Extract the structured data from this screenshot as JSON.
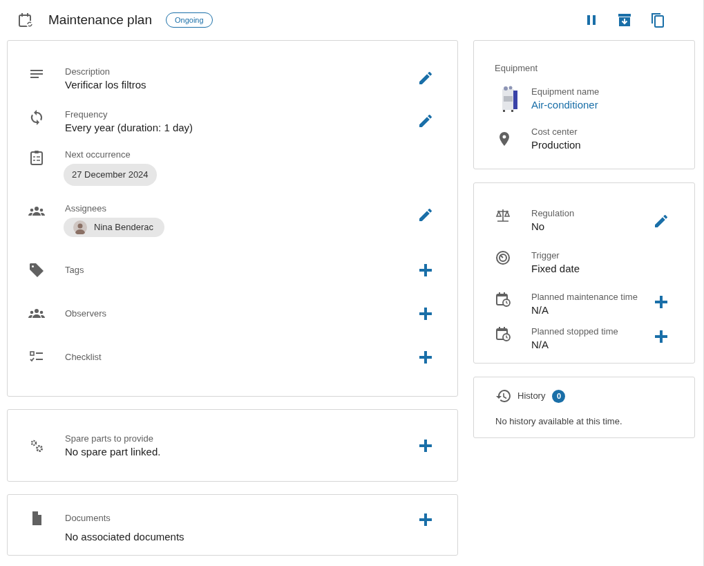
{
  "header": {
    "title": "Maintenance plan",
    "status": "Ongoing"
  },
  "details": {
    "rows": [
      {
        "label": "Description",
        "value": "Verificar los filtros",
        "action": {
          "kind": "edit"
        }
      },
      {
        "label": "Frequency",
        "value": "Every year (duration: 1 day)",
        "action": {
          "kind": "edit"
        }
      },
      {
        "label": "Next occurrence",
        "chip": "27 December 2024"
      },
      {
        "label": "Assignees",
        "person": "Nina Benderac",
        "action": {
          "kind": "edit"
        }
      },
      {
        "label": "Tags",
        "action": {
          "kind": "add"
        }
      },
      {
        "label": "Observers",
        "action": {
          "kind": "add"
        }
      },
      {
        "label": "Checklist",
        "action": {
          "kind": "add"
        }
      }
    ]
  },
  "spare_parts": {
    "label": "Spare parts to provide",
    "value": "No spare part linked.",
    "action": {
      "kind": "add"
    }
  },
  "documents": {
    "label": "Documents",
    "value": "No associated documents",
    "action": {
      "kind": "add"
    }
  },
  "equipment": {
    "title": "Equipment",
    "name_label": "Equipment name",
    "name": "Air-conditioner",
    "cost_label": "Cost center",
    "cost": "Production"
  },
  "planning": {
    "rows": [
      {
        "label": "Regulation",
        "value": "No",
        "action": {
          "kind": "edit"
        }
      },
      {
        "label": "Trigger",
        "value": "Fixed date"
      },
      {
        "label": "Planned maintenance time",
        "value": "N/A",
        "action": {
          "kind": "add"
        }
      },
      {
        "label": "Planned stopped time",
        "value": "N/A",
        "action": {
          "kind": "add"
        }
      }
    ]
  },
  "history": {
    "title": "History",
    "count": "0",
    "empty": "No history available at this time."
  }
}
